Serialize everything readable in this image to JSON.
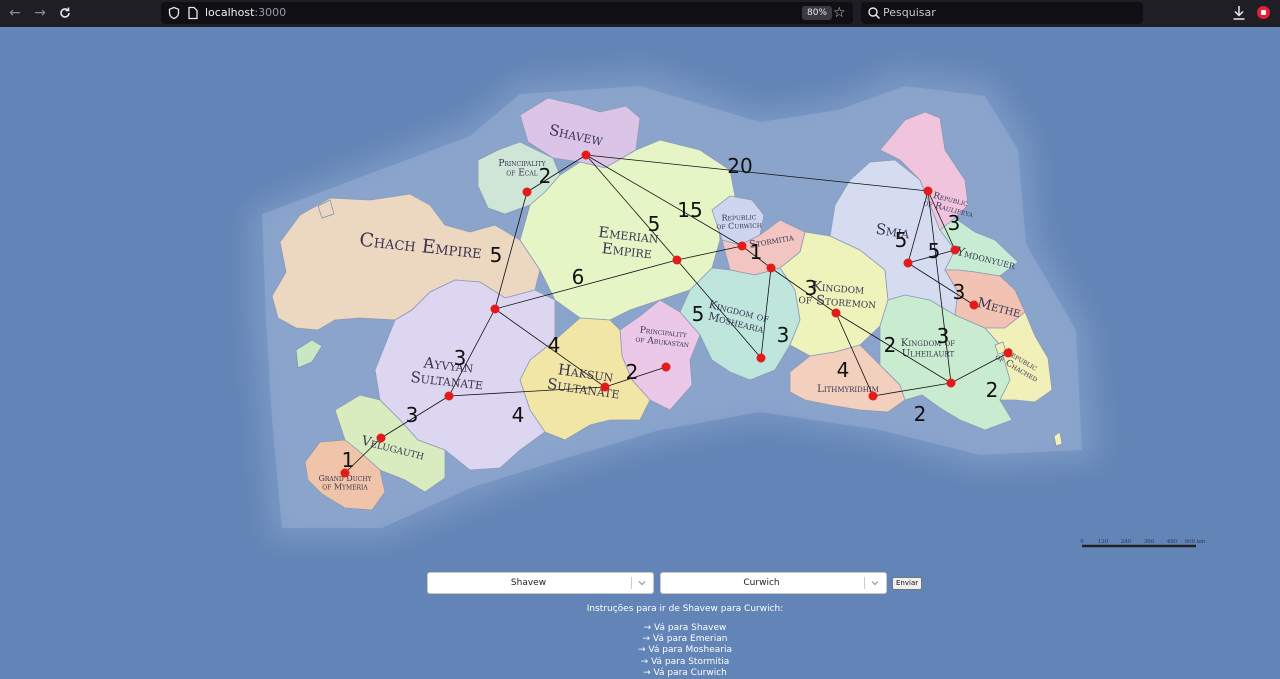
{
  "browser": {
    "host": "localhost",
    "port": ":3000",
    "zoom": "80%",
    "search_placeholder": "Pesquisar"
  },
  "map": {
    "regions": [
      {
        "name": "Shavew",
        "label": "Shavew",
        "color": "#dcc4e6"
      },
      {
        "name": "Principality of Ecal",
        "label_lines": [
          "Principality",
          "of Ecal"
        ],
        "color": "#cfe6d6"
      },
      {
        "name": "Emerian Empire",
        "label_lines": [
          "Emerian",
          "Empire"
        ],
        "color": "#e6f5c6"
      },
      {
        "name": "Chach Empire",
        "label": "Chach Empire",
        "color": "#ecd7c0"
      },
      {
        "name": "Republic of Curwich",
        "label_lines": [
          "Republic",
          "of Curwich"
        ],
        "color": "#cdd6ee"
      },
      {
        "name": "Stormitia",
        "label": "Stormitia",
        "color": "#f2c4c2"
      },
      {
        "name": "Kingdom of Mosheria",
        "label_lines": [
          "Kingdom of",
          "Moshearia"
        ],
        "color": "#bfe6dd"
      },
      {
        "name": "Principality of Abukastan",
        "label_lines": [
          "Principality",
          "of Abukastan"
        ],
        "color": "#ecc8e8"
      },
      {
        "name": "Haksun Sultanate",
        "label_lines": [
          "Haksun",
          "Sultanate"
        ],
        "color": "#f2e6a6"
      },
      {
        "name": "Ayvyan Sultanate",
        "label_lines": [
          "Ayvyan",
          "Sultanate"
        ],
        "color": "#dcd6f0"
      },
      {
        "name": "Velugauth",
        "label": "Velugauth",
        "color": "#d9ecc0"
      },
      {
        "name": "Grand Duchy of Mymeria",
        "label_lines": [
          "Grand Duchy",
          "of Mymeria"
        ],
        "color": "#f0c4a8"
      },
      {
        "name": "Kingdom of Storemon",
        "label_lines": [
          "Kingdom",
          "of Storemon"
        ],
        "color": "#eef2bb"
      },
      {
        "name": "Lithmyridhim",
        "label": "Lithmyridhim",
        "color": "#f2d0bd"
      },
      {
        "name": "Kingdom of Ulheilaurt",
        "label_lines": [
          "Kingdom of",
          "Ulheilaurt"
        ],
        "color": "#c9ecd0"
      },
      {
        "name": "Smia",
        "label": "Smia",
        "color": "#d6dcf0"
      },
      {
        "name": "Republic of Raulifeya",
        "label_lines": [
          "Republic",
          "of Raulifeya"
        ],
        "color": "#f0c4dc"
      },
      {
        "name": "Ymdonyuer",
        "label": "Ymdonyuer",
        "color": "#c6ecd4"
      },
      {
        "name": "Methe",
        "label": "Methe",
        "color": "#f2c2b3"
      },
      {
        "name": "Republic of Chached",
        "label_lines": [
          "Republic",
          "of Chached"
        ],
        "color": "#f0f0b8"
      }
    ],
    "edge_weights": [
      "2",
      "20",
      "15",
      "5",
      "5",
      "6",
      "1",
      "3",
      "3",
      "5",
      "2",
      "4",
      "3",
      "4",
      "3",
      "1",
      "4",
      "2",
      "2",
      "2",
      "3",
      "5",
      "5",
      "3",
      "3"
    ],
    "scale_bar": {
      "ticks": [
        "0",
        "120",
        "240",
        "360",
        "480",
        "600 km"
      ]
    }
  },
  "controls": {
    "origin_value": "Shavew",
    "destination_value": "Curwich",
    "submit_label": "Enviar"
  },
  "instructions": {
    "title": "Instruções para ir de Shavew para Curwich:",
    "steps": [
      "→ Vá para Shavew",
      "→ Vá para Emerian",
      "→ Vá para Moshearia",
      "→ Vá para Stormitia",
      "→ Vá para Curwich"
    ]
  }
}
